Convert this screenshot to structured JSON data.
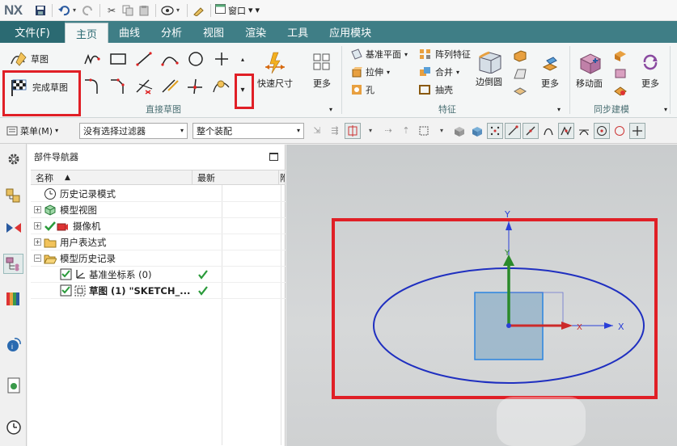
{
  "app": {
    "logo": "NX",
    "window_menu_label": "窗口"
  },
  "tabs": [
    {
      "label": "文件(F)"
    },
    {
      "label": "主页"
    },
    {
      "label": "曲线"
    },
    {
      "label": "分析"
    },
    {
      "label": "视图"
    },
    {
      "label": "渲染"
    },
    {
      "label": "工具"
    },
    {
      "label": "应用模块"
    }
  ],
  "ribbon": {
    "sketch_label": "草图",
    "finish_sketch_label": "完成草图",
    "direct_sketch_group": "直接草图",
    "rapid_dimension_label": "快速尺寸",
    "more_label": "更多",
    "datum_plane_label": "基准平面",
    "pattern_feature_label": "阵列特征",
    "extrude_label": "拉伸",
    "unite_label": "合并",
    "hole_label": "孔",
    "shell_label": "抽壳",
    "edge_blend_label": "边倒圆",
    "feature_group": "特征",
    "move_face_label": "移动面",
    "sync_modeling_group": "同步建模"
  },
  "toolrow": {
    "menu_label": "菜单(M)",
    "filter_value": "没有选择过滤器",
    "assembly_value": "整个装配"
  },
  "navigator": {
    "title": "部件导航器",
    "col_name": "名称",
    "col_latest": "最新",
    "col_third": "附",
    "items": [
      {
        "label": "历史记录模式"
      },
      {
        "label": "模型视图"
      },
      {
        "label": "摄像机"
      },
      {
        "label": "用户表达式"
      },
      {
        "label": "模型历史记录"
      },
      {
        "label": "基准坐标系 (0)"
      },
      {
        "label": "草图 (1) \"SKETCH_..."
      }
    ]
  },
  "graphics": {
    "axis_x": "X",
    "axis_y": "Y",
    "colors": {
      "ellipse": "#1f2fc0",
      "square_fill": "#8fb0c8",
      "square_stroke": "#2a84e0",
      "highlight": "#e01f26"
    }
  }
}
